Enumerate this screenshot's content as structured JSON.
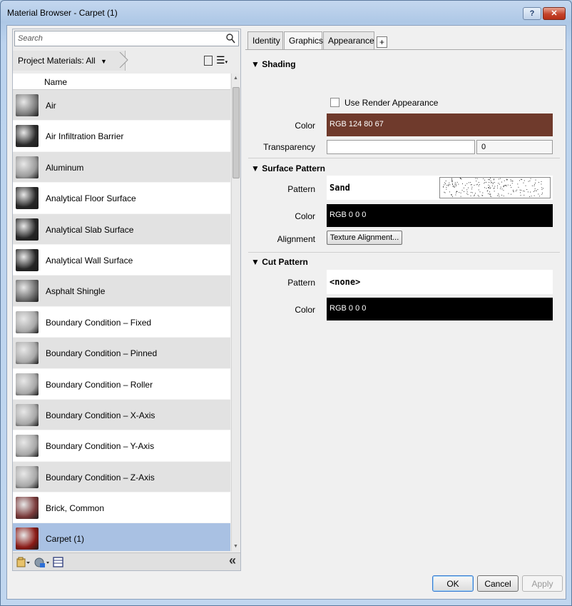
{
  "window": {
    "title": "Material Browser - Carpet (1)",
    "help_label": "?",
    "close_label": "✕"
  },
  "left": {
    "search_placeholder": "Search",
    "filter_label": "Project Materials: All",
    "filter_arrow": "▼",
    "column_header": "Name",
    "materials": [
      {
        "name": "Air",
        "thumb": "#7d7d7d"
      },
      {
        "name": "Air Infiltration Barrier",
        "thumb": "#2b2b2b"
      },
      {
        "name": "Aluminum",
        "thumb": "#9c9c9c"
      },
      {
        "name": "Analytical Floor Surface",
        "thumb": "#262626"
      },
      {
        "name": "Analytical Slab Surface",
        "thumb": "#262626"
      },
      {
        "name": "Analytical Wall Surface",
        "thumb": "#262626"
      },
      {
        "name": "Asphalt Shingle",
        "thumb": "#6c6c6c"
      },
      {
        "name": "Boundary Condition – Fixed",
        "thumb": "#a8a8a8"
      },
      {
        "name": "Boundary Condition – Pinned",
        "thumb": "#a8a8a8"
      },
      {
        "name": "Boundary Condition – Roller",
        "thumb": "#a8a8a8"
      },
      {
        "name": "Boundary Condition – X-Axis",
        "thumb": "#a8a8a8"
      },
      {
        "name": "Boundary Condition – Y-Axis",
        "thumb": "#a8a8a8"
      },
      {
        "name": "Boundary Condition – Z-Axis",
        "thumb": "#a8a8a8"
      },
      {
        "name": "Brick, Common",
        "thumb": "#7a3a3a"
      },
      {
        "name": "Carpet (1)",
        "thumb": "#8a1a16"
      }
    ],
    "collapse_label": "«"
  },
  "tabs": [
    "Identity",
    "Graphics",
    "Appearance",
    "+"
  ],
  "shading": {
    "header": "▼ Shading",
    "use_render_label": "Use Render Appearance",
    "color_label": "Color",
    "color_value": "RGB 124 80 67",
    "color_hex": "#7c5043",
    "transparency_label": "Transparency",
    "transparency_value": "0"
  },
  "surface": {
    "header": "▼ Surface Pattern",
    "pattern_label": "Pattern",
    "pattern_value": "Sand",
    "color_label": "Color",
    "color_value": "RGB 0 0 0",
    "alignment_label": "Alignment",
    "alignment_button": "Texture Alignment..."
  },
  "cut": {
    "header": "▼ Cut Pattern",
    "pattern_label": "Pattern",
    "pattern_value": "<none>",
    "color_label": "Color",
    "color_value": "RGB 0 0 0"
  },
  "buttons": {
    "ok": "OK",
    "cancel": "Cancel",
    "apply": "Apply"
  }
}
